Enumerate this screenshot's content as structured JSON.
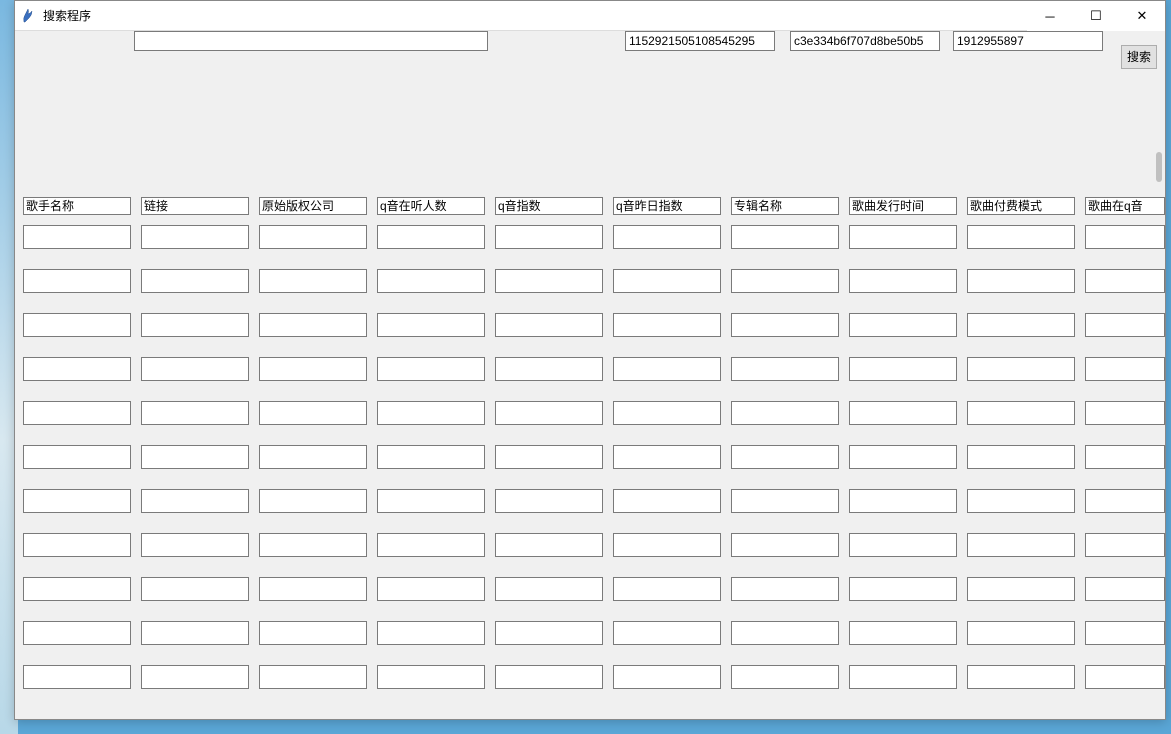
{
  "window": {
    "title": "搜索程序"
  },
  "titlebar": {
    "minimize_glyph": "─",
    "maximize_glyph": "☐",
    "close_glyph": "✕"
  },
  "top": {
    "search_value": "",
    "field1": "1152921505108545295",
    "field2": "c3e334b6f707d8be50b5",
    "field3": "1912955897",
    "search_button": "搜索"
  },
  "columns": [
    "歌手名称",
    "链接",
    "原始版权公司",
    "q音在听人数",
    "q音指数",
    "q音昨日指数",
    "专辑名称",
    "歌曲发行时间",
    "歌曲付费模式",
    "歌曲在q音"
  ],
  "rows": [
    [
      "",
      "",
      "",
      "",
      "",
      "",
      "",
      "",
      "",
      ""
    ],
    [
      "",
      "",
      "",
      "",
      "",
      "",
      "",
      "",
      "",
      ""
    ],
    [
      "",
      "",
      "",
      "",
      "",
      "",
      "",
      "",
      "",
      ""
    ],
    [
      "",
      "",
      "",
      "",
      "",
      "",
      "",
      "",
      "",
      ""
    ],
    [
      "",
      "",
      "",
      "",
      "",
      "",
      "",
      "",
      "",
      ""
    ],
    [
      "",
      "",
      "",
      "",
      "",
      "",
      "",
      "",
      "",
      ""
    ],
    [
      "",
      "",
      "",
      "",
      "",
      "",
      "",
      "",
      "",
      ""
    ],
    [
      "",
      "",
      "",
      "",
      "",
      "",
      "",
      "",
      "",
      ""
    ],
    [
      "",
      "",
      "",
      "",
      "",
      "",
      "",
      "",
      "",
      ""
    ],
    [
      "",
      "",
      "",
      "",
      "",
      "",
      "",
      "",
      "",
      ""
    ],
    [
      "",
      "",
      "",
      "",
      "",
      "",
      "",
      "",
      "",
      ""
    ]
  ]
}
